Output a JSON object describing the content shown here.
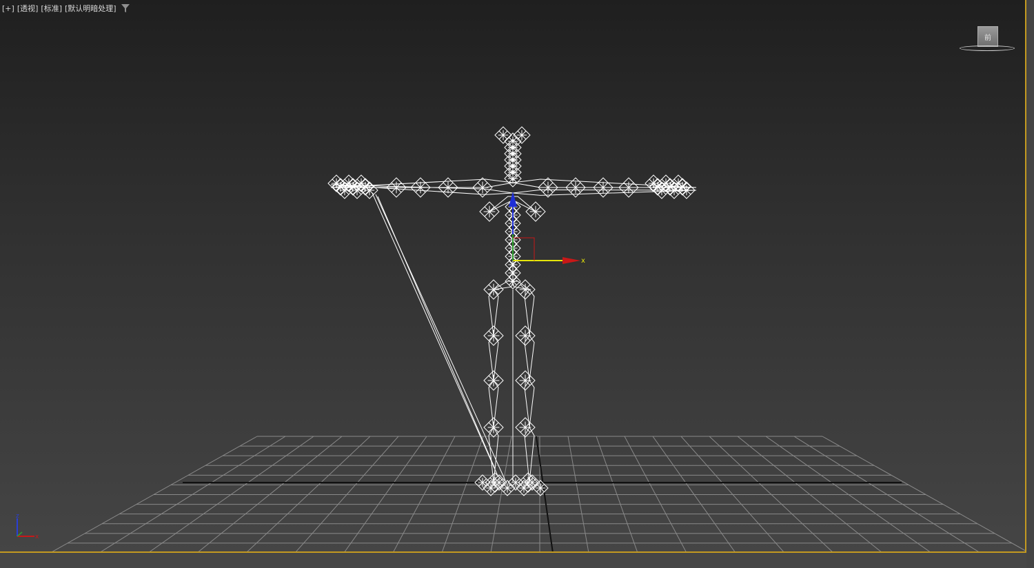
{
  "viewport": {
    "label_items": [
      "[+]",
      "[透视]",
      "[标准]",
      "[默认明暗处理]"
    ],
    "filter_icon": "funnel-icon",
    "border_color": "#c49a20",
    "gizmo_x_label": "x",
    "viewcube_label": "前",
    "tripod_z": "z",
    "tripod_x": "x",
    "colors": {
      "axis_x": "#c81818",
      "axis_y": "#2fa02f",
      "axis_z": "#1e2fd6",
      "gizmo_y": "#e6e60a",
      "skeleton": "#ffffff",
      "grid": "#8a8a8a"
    }
  }
}
